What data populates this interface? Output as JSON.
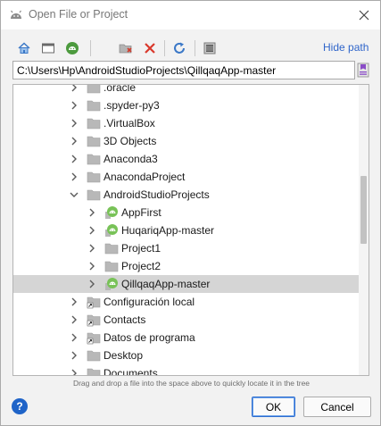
{
  "window": {
    "title": "Open File or Project",
    "icon": "android-studio-icon"
  },
  "toolbar": {
    "buttons": [
      "home-icon",
      "desktop-icon",
      "project-icon",
      "new-folder-icon",
      "delete-icon",
      "refresh-icon",
      "show-hidden-icon"
    ],
    "hide_path_label": "Hide path"
  },
  "path": {
    "value": "C:\\Users\\Hp\\AndroidStudioProjects\\QillqaqApp-master"
  },
  "tree": {
    "rows": [
      {
        "label": ".oracle",
        "level": 0,
        "icon": "folder",
        "expanded": false
      },
      {
        "label": ".spyder-py3",
        "level": 0,
        "icon": "folder",
        "expanded": false
      },
      {
        "label": ".VirtualBox",
        "level": 0,
        "icon": "folder",
        "expanded": false
      },
      {
        "label": "3D Objects",
        "level": 0,
        "icon": "folder",
        "expanded": false
      },
      {
        "label": "Anaconda3",
        "level": 0,
        "icon": "folder",
        "expanded": false
      },
      {
        "label": "AnacondaProject",
        "level": 0,
        "icon": "folder",
        "expanded": false
      },
      {
        "label": "AndroidStudioProjects",
        "level": 0,
        "icon": "folder",
        "expanded": true
      },
      {
        "label": "AppFirst",
        "level": 1,
        "icon": "android",
        "expanded": false
      },
      {
        "label": "HuqariqApp-master",
        "level": 1,
        "icon": "android",
        "expanded": false
      },
      {
        "label": "Project1",
        "level": 1,
        "icon": "folder",
        "expanded": false
      },
      {
        "label": "Project2",
        "level": 1,
        "icon": "folder",
        "expanded": false
      },
      {
        "label": "QillqaqApp-master",
        "level": 1,
        "icon": "android",
        "expanded": false,
        "selected": true
      },
      {
        "label": "Configuración local",
        "level": 0,
        "icon": "folder-link",
        "expanded": false
      },
      {
        "label": "Contacts",
        "level": 0,
        "icon": "folder-link",
        "expanded": false
      },
      {
        "label": "Datos de programa",
        "level": 0,
        "icon": "folder-link",
        "expanded": false
      },
      {
        "label": "Desktop",
        "level": 0,
        "icon": "folder",
        "expanded": false
      },
      {
        "label": "Documents",
        "level": 0,
        "icon": "folder",
        "expanded": false
      }
    ]
  },
  "hint": "Drag and drop a file into the space above to quickly locate it in the tree",
  "buttons": {
    "ok": "OK",
    "cancel": "Cancel",
    "help": "?"
  },
  "colors": {
    "accent": "#2f65ca",
    "selection": "#d5d5d5",
    "android_green": "#78c257"
  }
}
